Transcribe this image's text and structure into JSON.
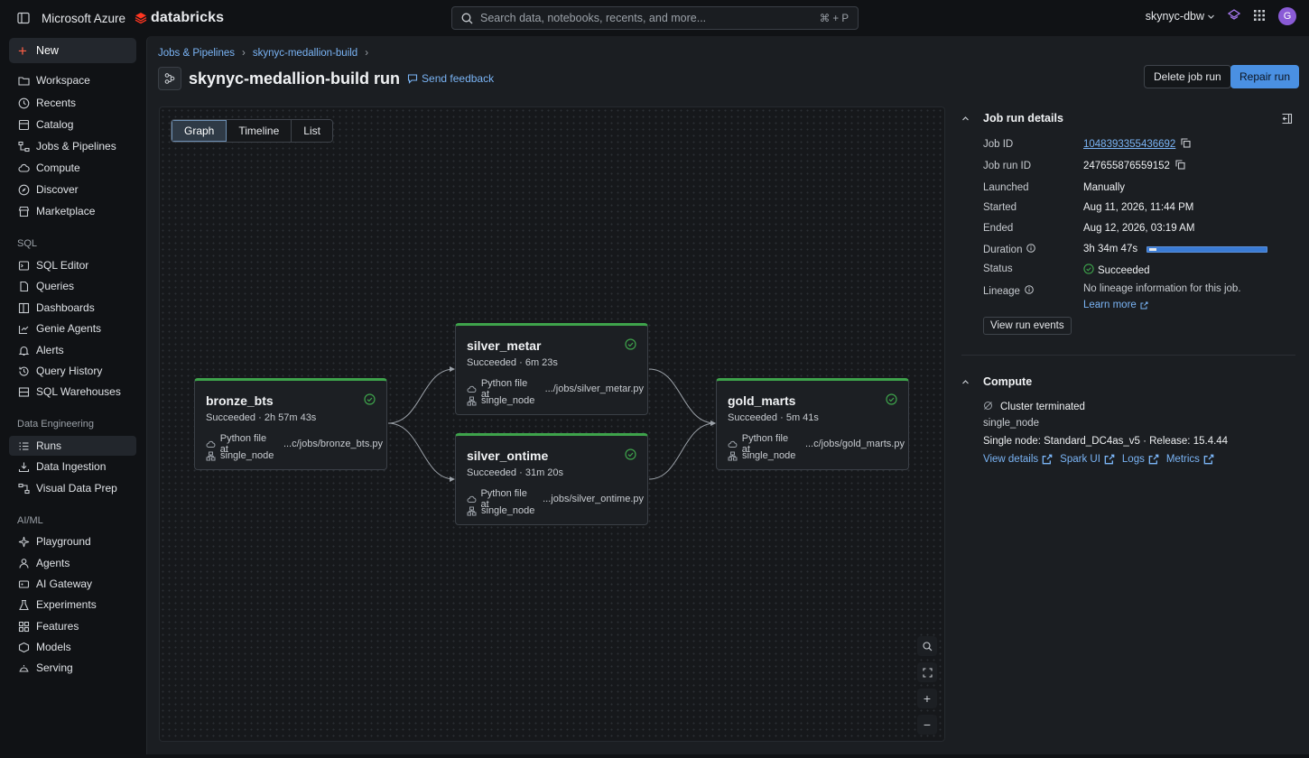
{
  "topbar": {
    "brand": "Microsoft Azure",
    "logo_text": "databricks",
    "search_placeholder": "Search data, notebooks, recents, and more...",
    "search_shortcut": "⌘ + P",
    "workspace": "skynyc-dbw",
    "avatar_initial": "G"
  },
  "sidebar": {
    "new_label": "New",
    "items": [
      {
        "label": "Workspace",
        "icon": "folder-icon"
      },
      {
        "label": "Recents",
        "icon": "clock-icon"
      },
      {
        "label": "Catalog",
        "icon": "catalog-icon"
      },
      {
        "label": "Jobs & Pipelines",
        "icon": "workflow-icon"
      },
      {
        "label": "Compute",
        "icon": "cloud-icon"
      },
      {
        "label": "Discover",
        "icon": "compass-icon"
      },
      {
        "label": "Marketplace",
        "icon": "store-icon"
      }
    ],
    "sql_label": "SQL",
    "sql_items": [
      {
        "label": "SQL Editor",
        "icon": "sql-editor-icon"
      },
      {
        "label": "Queries",
        "icon": "queries-icon"
      },
      {
        "label": "Dashboards",
        "icon": "dashboard-icon"
      },
      {
        "label": "Genie Agents",
        "icon": "genie-icon"
      },
      {
        "label": "Alerts",
        "icon": "bell-icon"
      },
      {
        "label": "Query History",
        "icon": "history-icon"
      },
      {
        "label": "SQL Warehouses",
        "icon": "warehouse-icon"
      }
    ],
    "de_label": "Data Engineering",
    "de_items": [
      {
        "label": "Runs",
        "icon": "runs-icon",
        "active": true
      },
      {
        "label": "Data Ingestion",
        "icon": "ingestion-icon"
      },
      {
        "label": "Visual Data Prep",
        "icon": "data-prep-icon"
      }
    ],
    "ai_label": "AI/ML",
    "ai_items": [
      {
        "label": "Playground",
        "icon": "sparkle-icon"
      },
      {
        "label": "Agents",
        "icon": "agent-icon"
      },
      {
        "label": "AI Gateway",
        "icon": "gateway-icon"
      },
      {
        "label": "Experiments",
        "icon": "flask-icon"
      },
      {
        "label": "Features",
        "icon": "features-icon"
      },
      {
        "label": "Models",
        "icon": "models-icon"
      },
      {
        "label": "Serving",
        "icon": "serving-icon"
      }
    ]
  },
  "header": {
    "breadcrumb": [
      "Jobs & Pipelines",
      "skynyc-medallion-build"
    ],
    "title": "skynyc-medallion-build run",
    "feedback": "Send feedback",
    "delete_label": "Delete job run",
    "repair_label": "Repair run"
  },
  "view_tabs": [
    "Graph",
    "Timeline",
    "List"
  ],
  "active_view": "Graph",
  "tasks": [
    {
      "name": "bronze_bts",
      "status": "Succeeded",
      "duration": "2h 57m 43s",
      "source_label": "Python file at",
      "path": "...c/jobs/bronze_bts.py",
      "cluster": "single_node"
    },
    {
      "name": "silver_metar",
      "status": "Succeeded",
      "duration": "6m 23s",
      "source_label": "Python file at",
      "path": ".../jobs/silver_metar.py",
      "cluster": "single_node"
    },
    {
      "name": "silver_ontime",
      "status": "Succeeded",
      "duration": "31m 20s",
      "source_label": "Python file at",
      "path": "...jobs/silver_ontime.py",
      "cluster": "single_node"
    },
    {
      "name": "gold_marts",
      "status": "Succeeded",
      "duration": "5m 41s",
      "source_label": "Python file at",
      "path": "...c/jobs/gold_marts.py",
      "cluster": "single_node"
    }
  ],
  "details": {
    "title": "Job run details",
    "job_id_label": "Job ID",
    "job_id": "1048393355436692",
    "run_id_label": "Job run ID",
    "run_id": "247655876559152",
    "launched_label": "Launched",
    "launched": "Manually",
    "started_label": "Started",
    "started": "Aug 11, 2026, 11:44 PM",
    "ended_label": "Ended",
    "ended": "Aug 12, 2026, 03:19 AM",
    "duration_label": "Duration",
    "duration": "3h 34m 47s",
    "status_label": "Status",
    "status": "Succeeded",
    "lineage_label": "Lineage",
    "lineage": "No lineage information for this job.",
    "learn_more": "Learn more",
    "view_events": "View run events"
  },
  "compute": {
    "title": "Compute",
    "state": "Cluster terminated",
    "cluster_name": "single_node",
    "spec": "Single node: Standard_DC4as_v5 · Release: 15.4.44",
    "links": [
      "View details",
      "Spark UI",
      "Logs",
      "Metrics"
    ]
  },
  "colors": {
    "success": "#3ea34b",
    "link": "#7ab4f5",
    "primary": "#4a90e2"
  }
}
